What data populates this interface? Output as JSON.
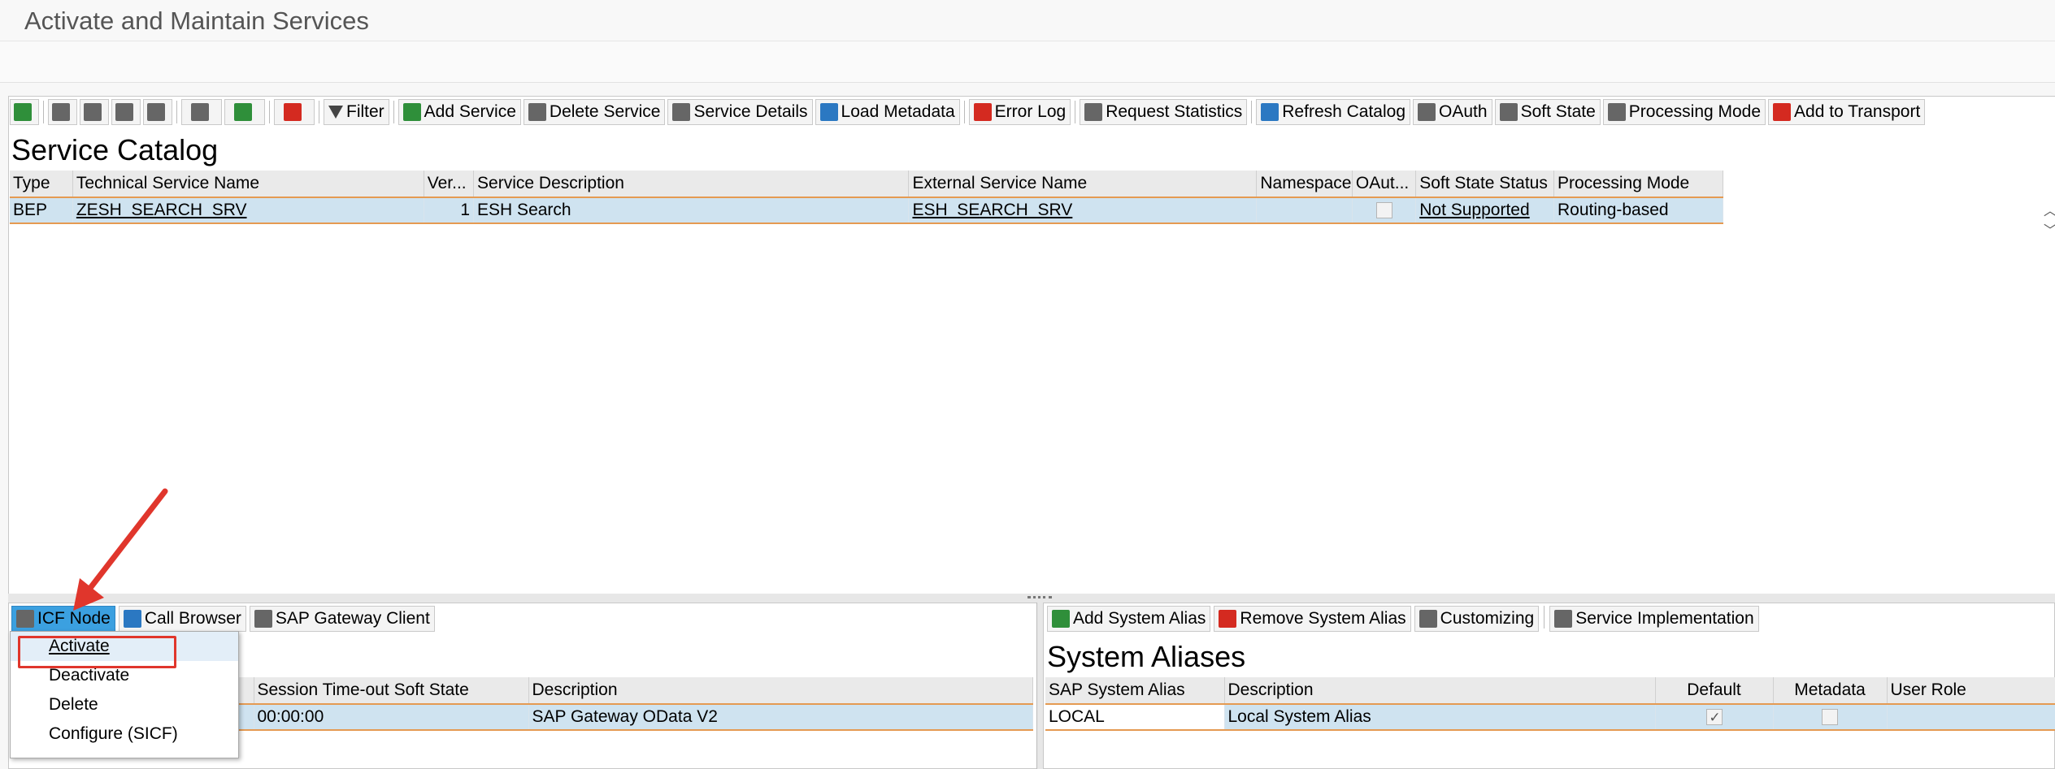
{
  "window": {
    "title": "Activate and Maintain Services"
  },
  "toolbar": {
    "filter": "Filter",
    "add_service": "Add Service",
    "delete_service": "Delete Service",
    "service_details": "Service Details",
    "load_metadata": "Load Metadata",
    "error_log": "Error Log",
    "request_statistics": "Request Statistics",
    "refresh_catalog": "Refresh Catalog",
    "oauth": "OAuth",
    "soft_state": "Soft State",
    "processing_mode": "Processing Mode",
    "add_to_transport": "Add to Transport"
  },
  "catalog": {
    "title": "Service Catalog",
    "columns": {
      "type": "Type",
      "tech_name": "Technical Service Name",
      "version": "Ver...",
      "description": "Service Description",
      "external_name": "External Service Name",
      "namespace": "Namespace",
      "oauth": "OAut...",
      "soft_state": "Soft State Status",
      "processing_mode": "Processing Mode"
    },
    "row": {
      "type": "BEP",
      "tech_name": "ZESH_SEARCH_SRV",
      "version": "1",
      "description": "ESH Search",
      "external_name": "ESH_SEARCH_SRV",
      "namespace": "",
      "oauth_checked": false,
      "soft_state": "Not Supported",
      "processing_mode": "Routing-based"
    }
  },
  "icf": {
    "toolbar": {
      "icf_node": "ICF Node",
      "call_browser": "Call Browser",
      "gateway_client": "SAP Gateway Client"
    },
    "menu": [
      "Activate",
      "Deactivate",
      "Delete",
      "Configure (SICF)"
    ],
    "columns": {
      "timeout": "Session Time-out Soft State",
      "description": "Description"
    },
    "row": {
      "timeout": "00:00:00",
      "description": "SAP Gateway OData V2"
    }
  },
  "aliases": {
    "toolbar": {
      "add": "Add System Alias",
      "remove": "Remove System Alias",
      "customizing": "Customizing",
      "service_impl": "Service Implementation"
    },
    "title": "System Aliases",
    "columns": {
      "alias": "SAP System Alias",
      "description": "Description",
      "default": "Default",
      "metadata": "Metadata",
      "user_role": "User Role"
    },
    "row": {
      "alias": "LOCAL",
      "description": "Local System Alias",
      "default_checked": true,
      "metadata_checked": false,
      "user_role": ""
    }
  }
}
